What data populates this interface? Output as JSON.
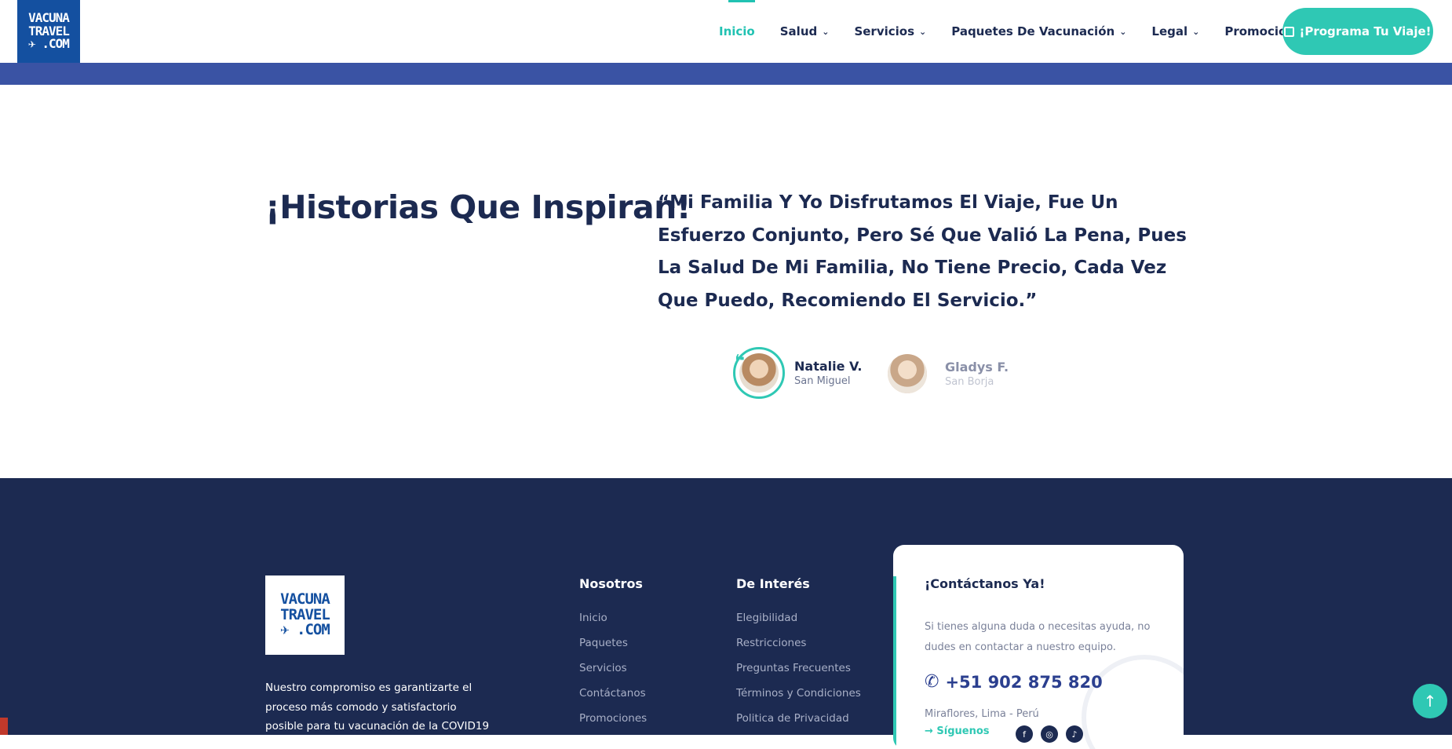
{
  "header": {
    "logo_lines": [
      "VACUNA",
      "TRAVEL",
      "✈ .COM"
    ],
    "nav": [
      {
        "label": "Inicio",
        "active": true,
        "has_dropdown": false
      },
      {
        "label": "Salud",
        "active": false,
        "has_dropdown": true
      },
      {
        "label": "Servicios",
        "active": false,
        "has_dropdown": true
      },
      {
        "label": "Paquetes De Vacunación",
        "active": false,
        "has_dropdown": true
      },
      {
        "label": "Legal",
        "active": false,
        "has_dropdown": true
      },
      {
        "label": "Promociones",
        "active": false,
        "has_dropdown": false
      }
    ],
    "cta_label": "¡Programa Tu Viaje!"
  },
  "testimonials": {
    "title": "¡Historias Que Inspiran!",
    "quote": "“Mi Familia Y Yo Disfrutamos El Viaje, Fue Un Esfuerzo Conjunto, Pero Sé Que Valió La Pena, Pues La Salud De Mi Familia, No Tiene Precio, Cada Vez Que Puedo, Recomiendo El Servicio.”",
    "quote_icon": "❝",
    "people": [
      {
        "name": "Natalie V.",
        "location": "San Miguel",
        "active": true
      },
      {
        "name": "Gladys F.",
        "location": "San Borja",
        "active": false
      }
    ]
  },
  "footer": {
    "logo_lines": [
      "VACUNA",
      "TRAVEL",
      "✈ .COM"
    ],
    "description": "Nuestro compromiso es garantizarte el proceso más comodo y satisfactorio posible para tu vacunación de la COVID19",
    "columns": [
      {
        "title": "Nosotros",
        "links": [
          "Inicio",
          "Paquetes",
          "Servicios",
          "Contáctanos",
          "Promociones"
        ]
      },
      {
        "title": "De Interés",
        "links": [
          "Elegibilidad",
          "Restricciones",
          "Preguntas Frecuentes",
          "Términos y Condiciones",
          "Politica de Privacidad"
        ]
      }
    ],
    "contact": {
      "title": "¡Contáctanos Ya!",
      "text": "Si tienes alguna duda o necesitas ayuda, no dudes en contactar a nuestro equipo.",
      "phone": "+51 902 875 820",
      "address": "Miraflores, Lima - Perú",
      "follow_label": "→ Síguenos",
      "social_icons": [
        "facebook-icon",
        "instagram-icon",
        "tiktok-icon"
      ]
    },
    "scroll_top_icon": "↑"
  },
  "colors": {
    "accent": "#2fc8b4",
    "navy": "#1c2a51",
    "band": "#3a53a4",
    "logo_blue": "#1450a0"
  }
}
